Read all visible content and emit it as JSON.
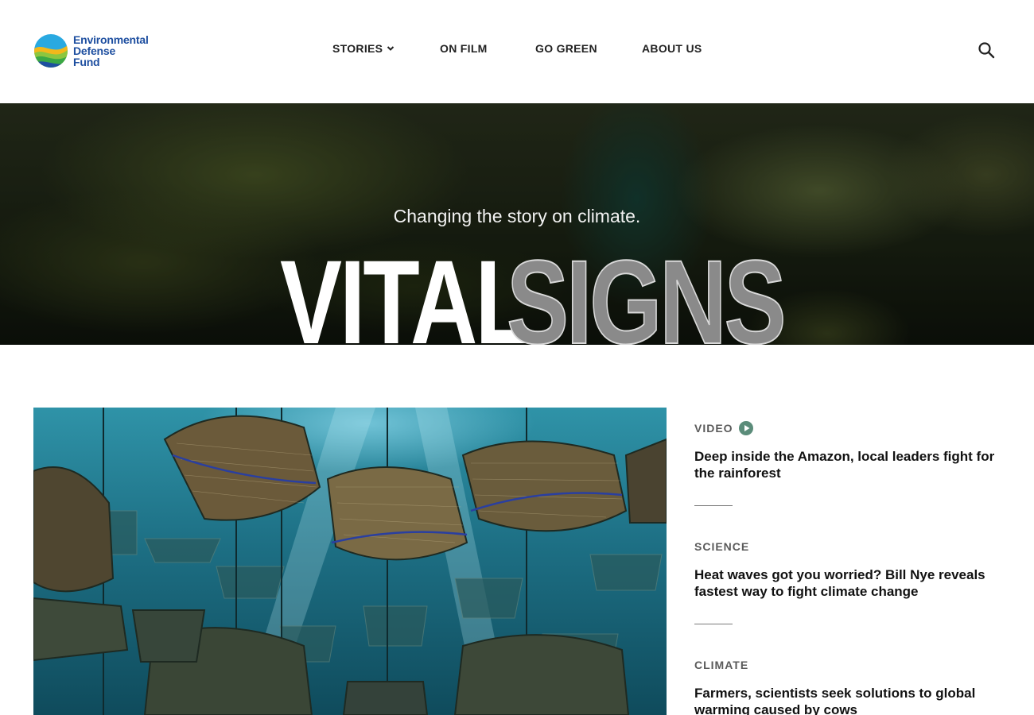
{
  "header": {
    "logo": {
      "line1": "Environmental",
      "line2": "Defense",
      "line3": "Fund"
    },
    "nav": [
      {
        "label": "STORIES",
        "has_dropdown": true
      },
      {
        "label": "ON FILM"
      },
      {
        "label": "GO GREEN"
      },
      {
        "label": "ABOUT US"
      }
    ],
    "search_icon": "search-icon"
  },
  "hero": {
    "tagline": "Changing the story on climate.",
    "title_part1": "VITAL",
    "title_part2": "SIGNS"
  },
  "feature": {
    "image": "underwater-oyster-baskets"
  },
  "side_stories": [
    {
      "category": "VIDEO",
      "has_play_icon": true,
      "headline": "Deep inside the Amazon, local leaders fight for the rainforest"
    },
    {
      "category": "SCIENCE",
      "headline": "Heat waves got you worried? Bill Nye reveals fastest way to fight climate change"
    },
    {
      "category": "CLIMATE",
      "headline": "Farmers, scientists seek solutions to global warming caused by cows"
    }
  ],
  "colors": {
    "brand_blue": "#1e4fa0",
    "brand_green": "#3aa845",
    "play_icon": "#5b8c7a",
    "category_text": "#5a5a5a"
  }
}
